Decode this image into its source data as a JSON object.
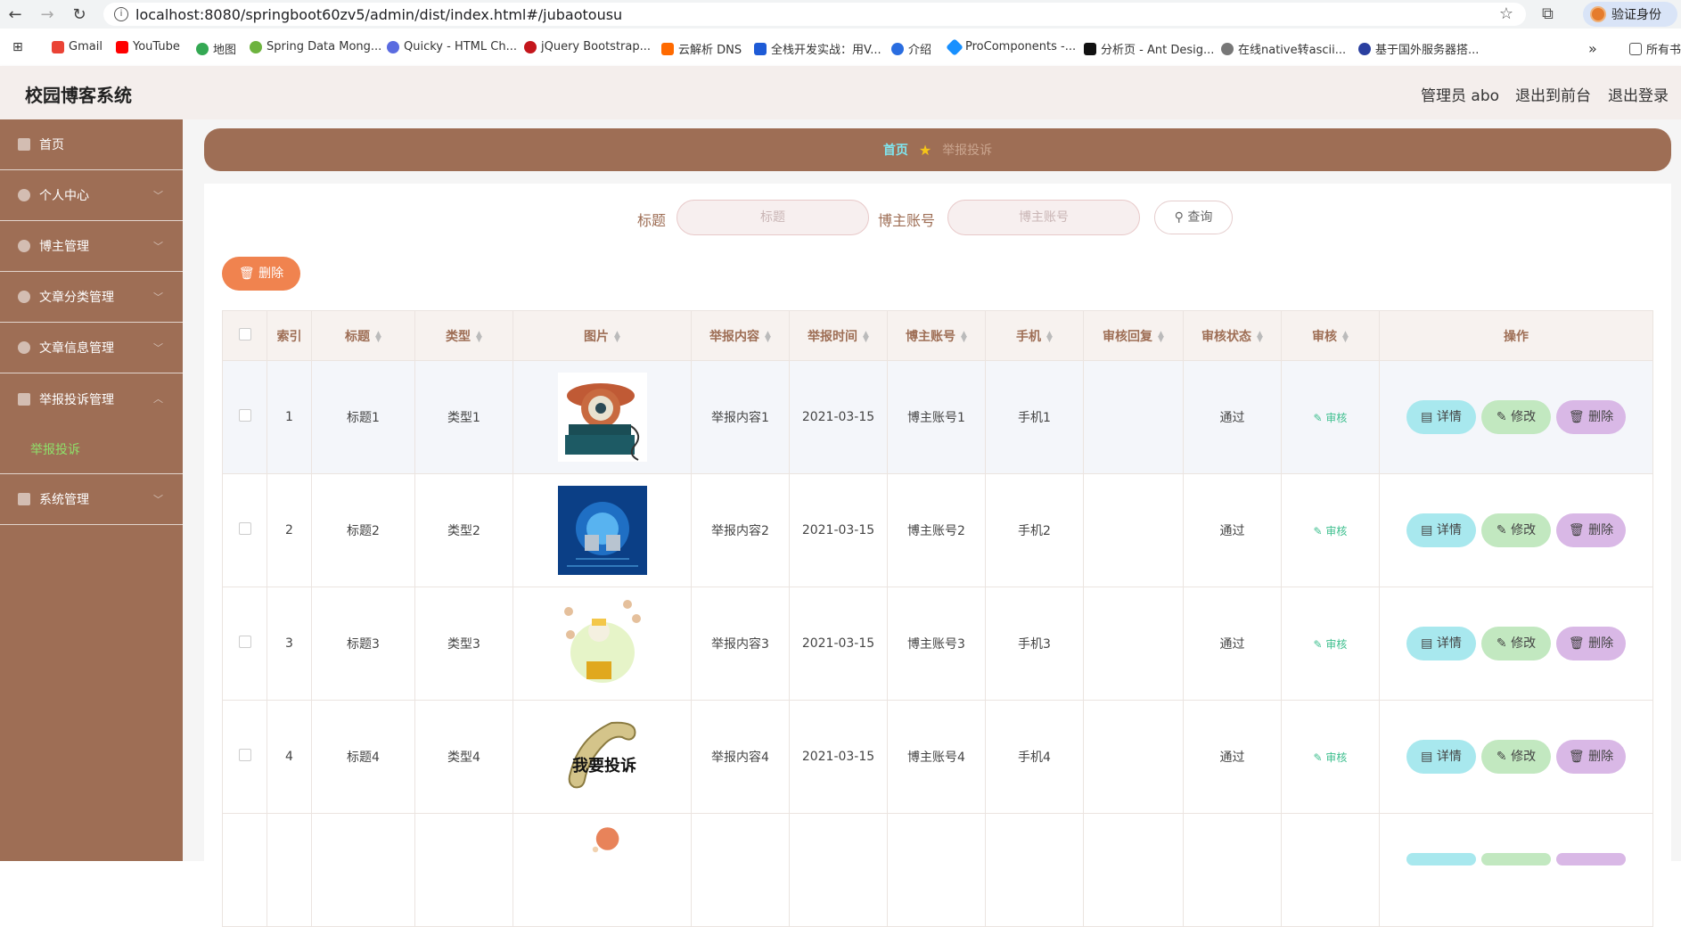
{
  "browser": {
    "url": "localhost:8080/springboot60zv5/admin/dist/index.html#/jubaotousu",
    "verify_label": "验证身份",
    "bookmarks": [
      "Gmail",
      "YouTube",
      "地图",
      "Spring Data Mong...",
      "Quicky - HTML Ch...",
      "jQuery Bootstrap...",
      "云解析 DNS",
      "全栈开发实战：用V...",
      "介绍",
      "ProComponents -...",
      "分析页 - Ant Desig...",
      "在线native转ascii...",
      "基于国外服务器搭..."
    ],
    "bookmarks_more": "»",
    "all_bookmarks": "所有书"
  },
  "header": {
    "title": "校园博客系统",
    "user": "管理员 abo",
    "to_front": "退出到前台",
    "logout": "退出登录"
  },
  "sidebar": {
    "items": [
      {
        "label": "首页"
      },
      {
        "label": "个人中心"
      },
      {
        "label": "博主管理"
      },
      {
        "label": "文章分类管理"
      },
      {
        "label": "文章信息管理"
      },
      {
        "label": "举报投诉管理"
      },
      {
        "label": "系统管理"
      }
    ],
    "sub_active": "举报投诉"
  },
  "breadcrumb": {
    "home": "首页",
    "current": "举报投诉"
  },
  "search": {
    "title_label": "标题",
    "title_placeholder": "标题",
    "account_label": "博主账号",
    "account_placeholder": "博主账号",
    "query_label": "查询"
  },
  "actions": {
    "delete_label": "删除"
  },
  "table": {
    "headers": [
      "索引",
      "标题",
      "类型",
      "图片",
      "举报内容",
      "举报时间",
      "博主账号",
      "手机",
      "审核回复",
      "审核状态",
      "审核",
      "操作"
    ],
    "rows": [
      {
        "index": "1",
        "title": "标题1",
        "type": "类型1",
        "content": "举报内容1",
        "time": "2021-03-15",
        "account": "博主账号1",
        "phone": "手机1",
        "reply": "",
        "status": "通过",
        "audit": "审核"
      },
      {
        "index": "2",
        "title": "标题2",
        "type": "类型2",
        "content": "举报内容2",
        "time": "2021-03-15",
        "account": "博主账号2",
        "phone": "手机2",
        "reply": "",
        "status": "通过",
        "audit": "审核"
      },
      {
        "index": "3",
        "title": "标题3",
        "type": "类型3",
        "content": "举报内容3",
        "time": "2021-03-15",
        "account": "博主账号3",
        "phone": "手机3",
        "reply": "",
        "status": "通过",
        "audit": "审核"
      },
      {
        "index": "4",
        "title": "标题4",
        "type": "类型4",
        "content": "举报内容4",
        "time": "2021-03-15",
        "account": "博主账号4",
        "phone": "手机4",
        "reply": "",
        "status": "通过",
        "audit": "审核"
      }
    ],
    "row_actions": {
      "detail": "详情",
      "edit": "修改",
      "delete": "删除"
    },
    "image_text": "我要投诉"
  },
  "colors": {
    "brand": "#9e6e55",
    "accent_green": "#8ee06a",
    "crumb_home": "#7fe6f0",
    "delete_orange": "#f0834f"
  }
}
